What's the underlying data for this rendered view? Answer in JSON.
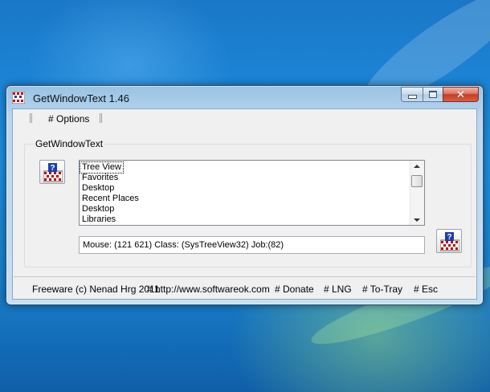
{
  "window": {
    "title": "GetWindowText 1.46"
  },
  "menu": {
    "options_label": "# Options"
  },
  "group": {
    "label": "GetWindowText"
  },
  "list": {
    "items": [
      "Tree View",
      "Favorites",
      " Desktop",
      " Recent Places",
      "Desktop",
      " Libraries"
    ],
    "selected_index": 0
  },
  "status": {
    "text": "Mouse: (121 621) Class: (SysTreeView32) Job:(82)"
  },
  "footer": {
    "freeware": "Freeware (c) Nenad Hrg 2011",
    "website": "# http://www.softwareok.com",
    "donate": "# Donate",
    "lng": "# LNG",
    "to_tray": "# To-Tray",
    "esc": "# Esc"
  },
  "icons": {
    "app": "drag-finder-icon",
    "window_buttons": [
      "minimize-icon",
      "maximize-icon",
      "close-icon"
    ]
  },
  "colors": {
    "desktop": "#1e8ee0",
    "close_button": "#c63d26",
    "window_frame": "#b9d7ef"
  }
}
